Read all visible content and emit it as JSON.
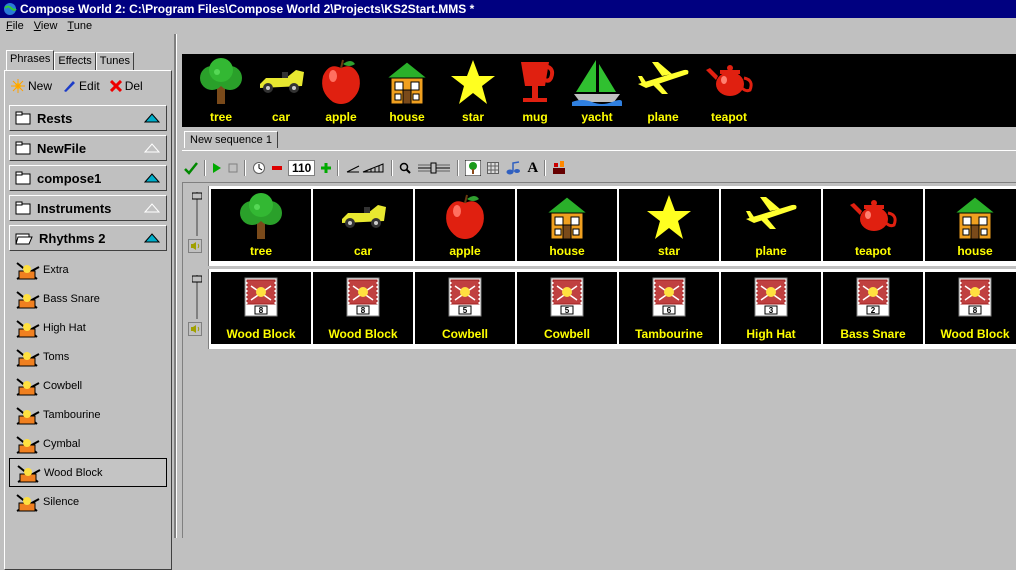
{
  "window": {
    "title": "Compose World 2: C:\\Program Files\\Compose World 2\\Projects\\KS2Start.MMS *"
  },
  "menu": [
    "File",
    "View",
    "Tune"
  ],
  "left_tabs": [
    {
      "label": "Phrases",
      "active": true
    },
    {
      "label": "Effects",
      "active": false
    },
    {
      "label": "Tunes",
      "active": false
    }
  ],
  "left_toolbar": {
    "new": "New",
    "edit": "Edit",
    "del": "Del"
  },
  "folders": [
    {
      "label": "Rests",
      "icon": "folder-closed-icon",
      "expanded": false
    },
    {
      "label": "NewFile",
      "icon": "folder-closed-icon",
      "expanded": false
    },
    {
      "label": "compose1",
      "icon": "folder-closed-icon",
      "expanded": false
    },
    {
      "label": "Instruments",
      "icon": "folder-closed-icon",
      "expanded": false
    },
    {
      "label": "Rhythms 2",
      "icon": "folder-open-icon",
      "expanded": true
    }
  ],
  "rhythm_items": [
    "Extra",
    "Bass Snare",
    "High Hat",
    "Toms",
    "Cowbell",
    "Tambourine",
    "Cymbal",
    "Wood Block",
    "Silence"
  ],
  "selected_item": "Wood Block",
  "palette": [
    "tree",
    "car",
    "apple",
    "house",
    "star",
    "mug",
    "yacht",
    "plane",
    "teapot"
  ],
  "sequence_tab": "New sequence 1",
  "tempo": "110",
  "track1": [
    "tree",
    "car",
    "apple",
    "house",
    "star",
    "plane",
    "teapot",
    "house"
  ],
  "track2": [
    {
      "label": "Wood Block",
      "num": "8"
    },
    {
      "label": "Wood Block",
      "num": "8"
    },
    {
      "label": "Cowbell",
      "num": "5"
    },
    {
      "label": "Cowbell",
      "num": "5"
    },
    {
      "label": "Tambourine",
      "num": "6"
    },
    {
      "label": "High Hat",
      "num": "3"
    },
    {
      "label": "Bass Snare",
      "num": "2"
    },
    {
      "label": "Wood Block",
      "num": "8"
    }
  ],
  "colors": {
    "titlebar": "#000080",
    "panel": "#c0c0c0",
    "label": "#ffff00",
    "tile": "#000000",
    "accent": "#00aeca"
  }
}
